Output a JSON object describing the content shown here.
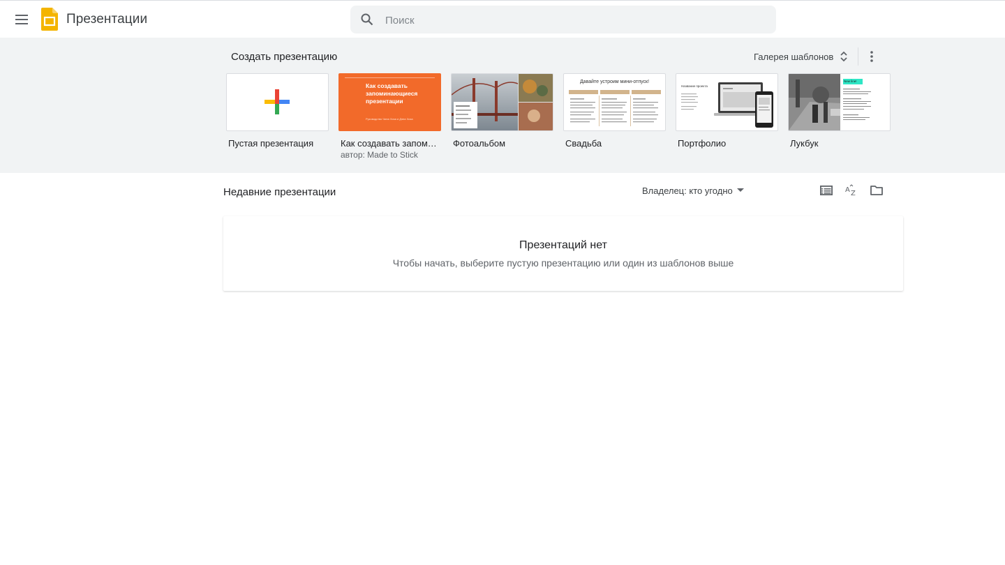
{
  "app": {
    "title": "Презентации",
    "brand_color": "#f4b400"
  },
  "search": {
    "placeholder": "Поиск",
    "value": ""
  },
  "templates": {
    "section_title": "Создать презентацию",
    "gallery_label": "Галерея шаблонов",
    "items": [
      {
        "name": "Пустая презентация",
        "subtitle": ""
      },
      {
        "name": "Как создавать запоминающиеся презентации",
        "subtitle": "автор: Made to Stick",
        "thumb_heading": "Как создавать запоминающиеся презентации",
        "thumb_caption": "Руководство Чипа Хиза и Дэна Хиза"
      },
      {
        "name": "Фотоальбом",
        "subtitle": ""
      },
      {
        "name": "Свадьба",
        "subtitle": "",
        "thumb_heading": "Давайте устроим мини-отпуск!"
      },
      {
        "name": "Портфолио",
        "subtitle": "",
        "thumb_heading": "Название проекта"
      },
      {
        "name": "Лукбук",
        "subtitle": "",
        "thumb_heading": "New line!"
      }
    ]
  },
  "recent": {
    "title": "Недавние презентации",
    "owner_filter": "Владелец: кто угодно",
    "empty_title": "Презентаций нет",
    "empty_subtitle": "Чтобы начать, выберите пустую презентацию или один из шаблонов выше"
  },
  "colors": {
    "accent_orange": "#f26a2a",
    "google_red": "#ea4335",
    "google_blue": "#4285f4",
    "google_green": "#34a853",
    "google_yellow": "#fbbc04"
  }
}
